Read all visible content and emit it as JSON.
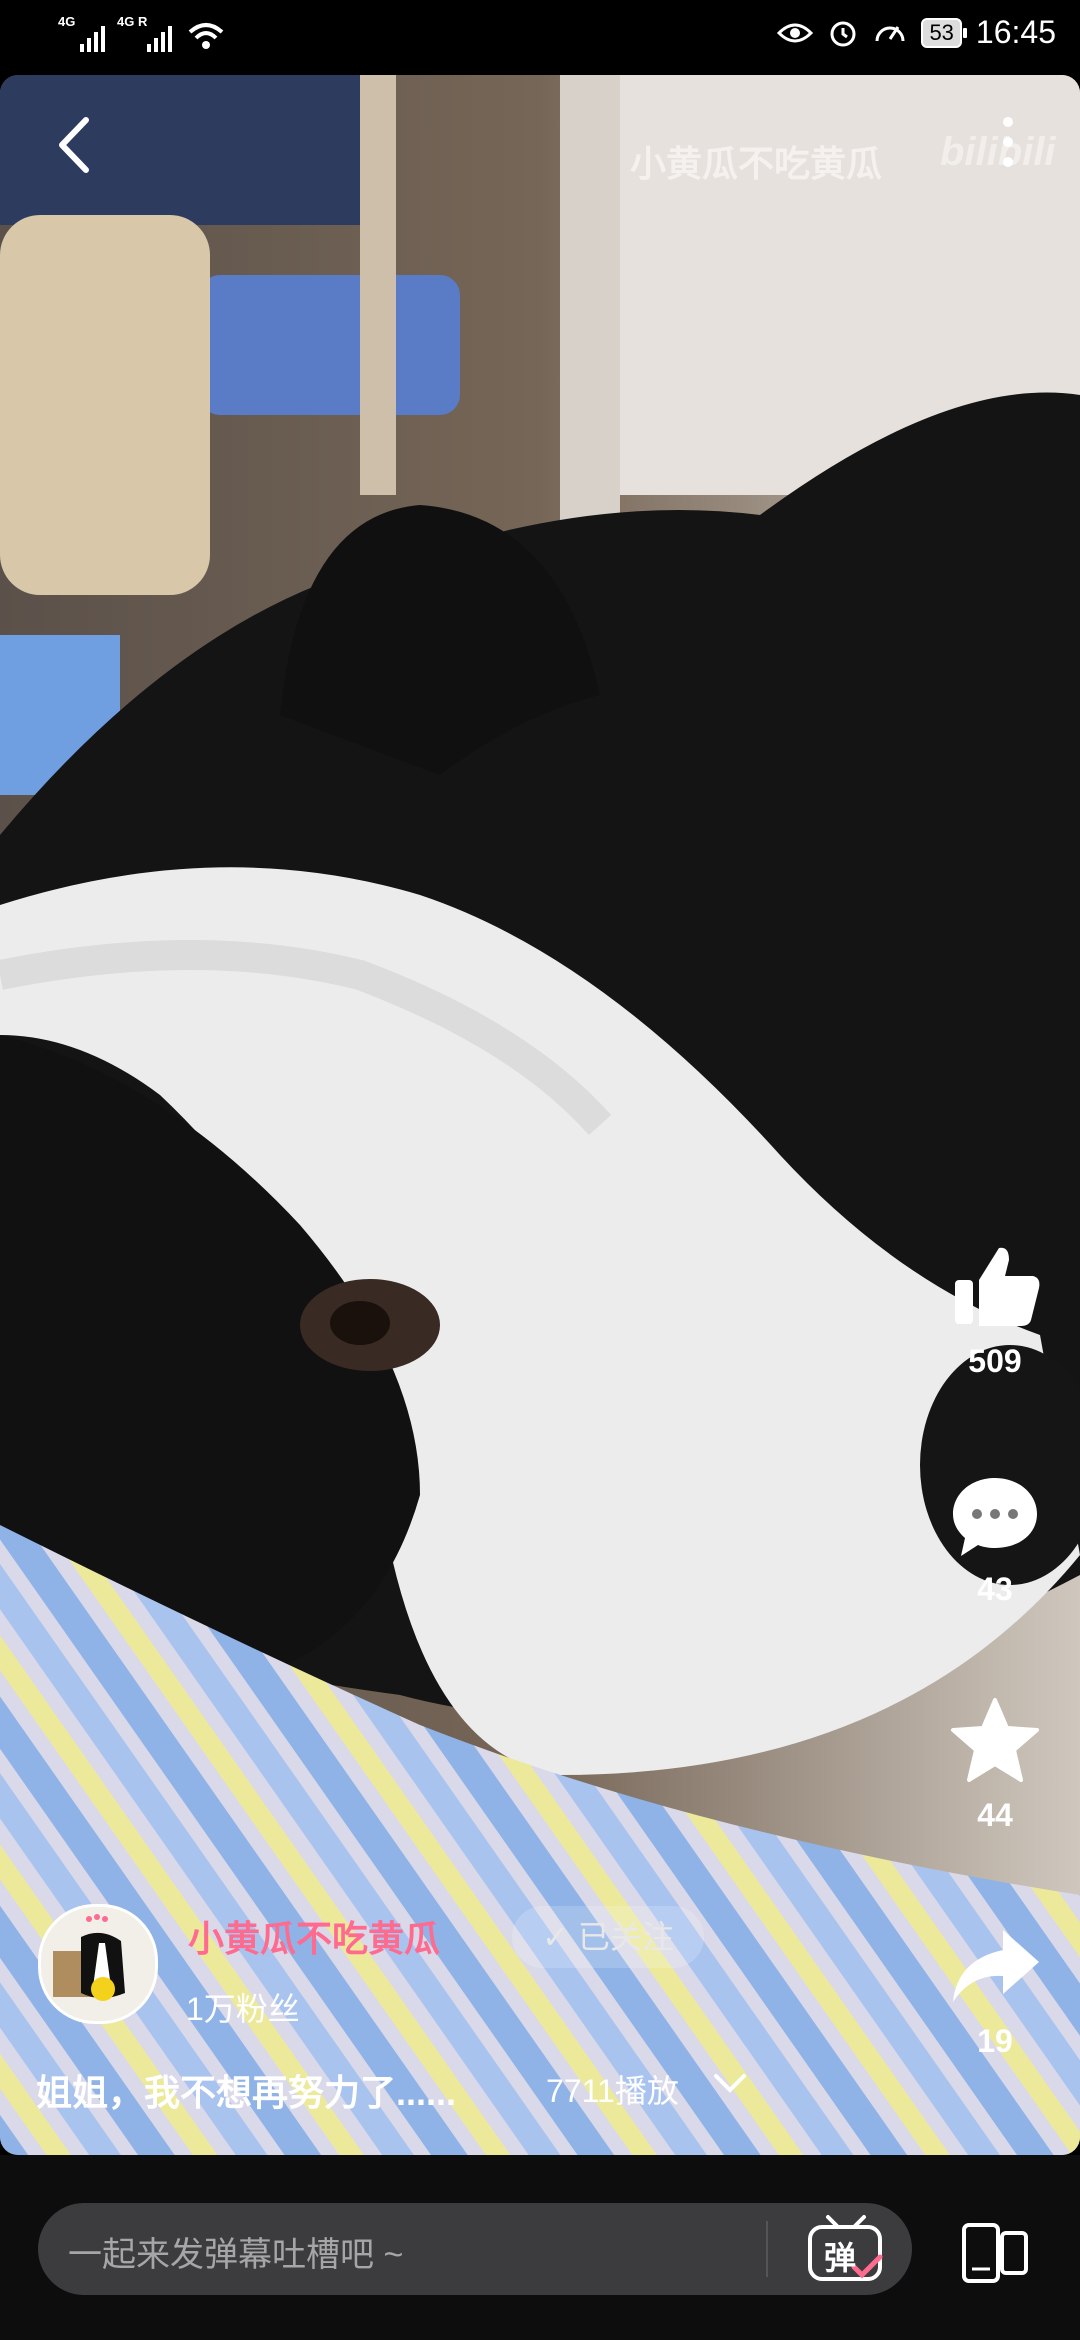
{
  "status_bar": {
    "signal1_label": "4G",
    "signal2_label": "4G R",
    "battery": "53",
    "time": "16:45",
    "icons": [
      "wifi-icon",
      "eye-icon",
      "alarm-icon",
      "speed-icon"
    ]
  },
  "video": {
    "watermark_text": "小黄瓜不吃黄瓜",
    "watermark_logo": "bilibili"
  },
  "actions": {
    "likes": "509",
    "comments": "43",
    "favorites": "44",
    "shares": "19"
  },
  "uploader": {
    "name": "小黄瓜不吃黄瓜",
    "follow_label": "已关注",
    "fans": "1万粉丝"
  },
  "video_info": {
    "title": "姐姐，我不想再努力了......",
    "plays": "7711播放"
  },
  "danmaku": {
    "placeholder": "一起来发弹幕吐槽吧 ~",
    "button_label": "弹"
  },
  "colors": {
    "accent_pink": "#ff6a8f",
    "background": "#000000"
  }
}
